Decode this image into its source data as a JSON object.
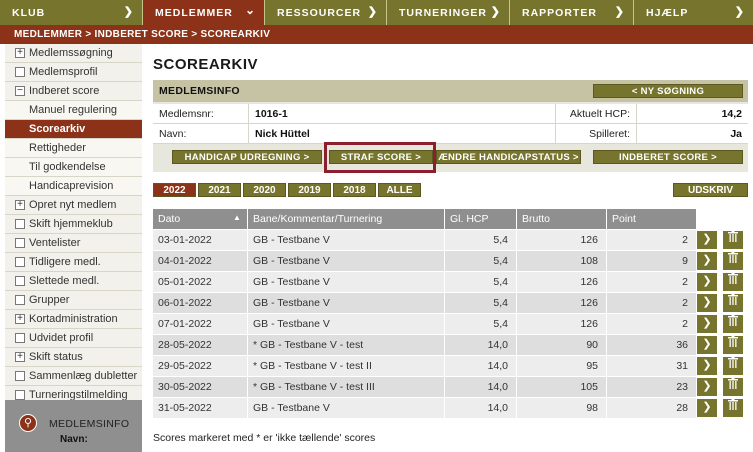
{
  "topnav": [
    {
      "label": "KLUB",
      "icon": "arrow-right-icon"
    },
    {
      "label": "MEDLEMMER",
      "icon": "chevron-down-icon"
    },
    {
      "label": "RESSOURCER",
      "icon": "arrow-right-icon"
    },
    {
      "label": "TURNERINGER",
      "icon": "arrow-right-icon"
    },
    {
      "label": "RAPPORTER",
      "icon": "arrow-right-icon"
    },
    {
      "label": "HJÆLP",
      "icon": "arrow-right-icon"
    }
  ],
  "breadcrumb": "MEDLEMMER > INDBERET SCORE > SCOREARKIV",
  "sidebar": [
    {
      "label": "Medlemssøgning",
      "marker": "+"
    },
    {
      "label": "Medlemsprofil",
      "marker": "box"
    },
    {
      "label": "Indberet score",
      "marker": "−"
    },
    {
      "label": "Manuel regulering",
      "marker": "sub"
    },
    {
      "label": "Scorearkiv",
      "marker": "sub-active"
    },
    {
      "label": "Rettigheder",
      "marker": "sub"
    },
    {
      "label": "Til godkendelse",
      "marker": "sub"
    },
    {
      "label": "Handicaprevision",
      "marker": "sub"
    },
    {
      "label": "Opret nyt medlem",
      "marker": "+"
    },
    {
      "label": "Skift hjemmeklub",
      "marker": "box"
    },
    {
      "label": "Ventelister",
      "marker": "box"
    },
    {
      "label": "Tidligere medl.",
      "marker": "box"
    },
    {
      "label": "Slettede medl.",
      "marker": "box"
    },
    {
      "label": "Grupper",
      "marker": "box"
    },
    {
      "label": "Kortadministration",
      "marker": "+"
    },
    {
      "label": "Udvidet profil",
      "marker": "box"
    },
    {
      "label": "Skift status",
      "marker": "+"
    },
    {
      "label": "Sammenlæg dubletter",
      "marker": "box"
    },
    {
      "label": "Turneringstilmelding",
      "marker": "box"
    }
  ],
  "medlemsinfo_panel": {
    "title": "MEDLEMSINFO",
    "navn_label": "Navn:"
  },
  "page_title": "SCOREARKIV",
  "memberinfo": {
    "title": "MEDLEMSINFO",
    "new_search_button": "< NY SØGNING",
    "medlemsnr_label": "Medlemsnr:",
    "medlemsnr": "1016-1",
    "hcp_label": "Aktuelt HCP:",
    "hcp": "14,2",
    "navn_label": "Navn:",
    "navn": "Nick Hüttel",
    "spilleret_label": "Spilleret:",
    "spilleret": "Ja",
    "buttons": {
      "handicap": "HANDICAP UDREGNING >",
      "straf": "STRAF SCORE >",
      "aendre": "ÆNDRE HANDICAPSTATUS >",
      "indberet": "INDBERET SCORE >"
    }
  },
  "years": [
    "2022",
    "2021",
    "2020",
    "2019",
    "2018",
    "ALLE"
  ],
  "active_year": "2022",
  "print_button": "UDSKRIV",
  "table": {
    "columns": [
      "Dato",
      "Bane/Kommentar/Turnering",
      "Gl. HCP",
      "Brutto",
      "Point"
    ],
    "sort_icon": "sort-up-icon",
    "rows": [
      [
        "03-01-2022",
        "GB - Testbane V",
        "5,4",
        "126",
        "2"
      ],
      [
        "04-01-2022",
        "GB - Testbane V",
        "5,4",
        "108",
        "9"
      ],
      [
        "05-01-2022",
        "GB - Testbane V",
        "5,4",
        "126",
        "2"
      ],
      [
        "06-01-2022",
        "GB - Testbane V",
        "5,4",
        "126",
        "2"
      ],
      [
        "07-01-2022",
        "GB - Testbane V",
        "5,4",
        "126",
        "2"
      ],
      [
        "28-05-2022",
        "* GB - Testbane V - test",
        "14,0",
        "90",
        "36"
      ],
      [
        "29-05-2022",
        "* GB - Testbane V - test II",
        "14,0",
        "95",
        "31"
      ],
      [
        "30-05-2022",
        "* GB - Testbane V - test III",
        "14,0",
        "105",
        "23"
      ],
      [
        "31-05-2022",
        "GB - Testbane V",
        "14,0",
        "98",
        "28"
      ]
    ]
  },
  "footnote": "Scores markeret med * er 'ikke tællende' scores",
  "colors": {
    "olive": "#77742d",
    "maroon": "#8b3218",
    "highlight": "#8b1f2e"
  }
}
